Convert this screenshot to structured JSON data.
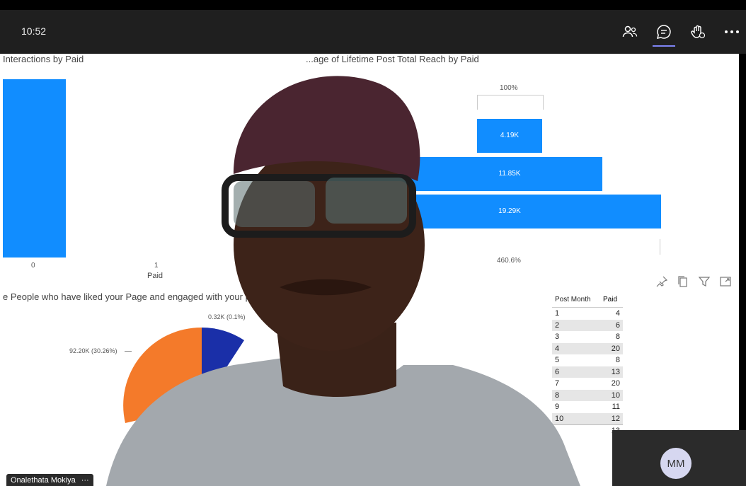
{
  "meeting": {
    "time": "10:52",
    "participant_name": "Onalethata Mokiya",
    "participant_more": "···",
    "avatar_initials": "MM",
    "icons": [
      "people-icon",
      "chat-icon",
      "raise-hand-icon",
      "more-icon"
    ]
  },
  "report": {
    "chart1": {
      "title": "Interactions by Paid",
      "x_ticks": [
        "0",
        "1"
      ],
      "xlabel": "Paid"
    },
    "chart2": {
      "title": "...age of Lifetime Post Total Reach by Paid",
      "top_pct": "100%",
      "bars": [
        "4.19K",
        "11.85K",
        "19.29K"
      ],
      "bottom_pct": "460.6%"
    },
    "chart3": {
      "title": "e People who have liked your Page and engaged with your p",
      "label_orange": "92.20K (30.26%)",
      "label_blue": "0.32K (0.1%)"
    },
    "table": {
      "headers": [
        "Post Month",
        "Paid"
      ],
      "rows": [
        [
          "1",
          "4"
        ],
        [
          "2",
          "6"
        ],
        [
          "3",
          "8"
        ],
        [
          "4",
          "20"
        ],
        [
          "5",
          "8"
        ],
        [
          "6",
          "13"
        ],
        [
          "7",
          "20"
        ],
        [
          "8",
          "10"
        ],
        [
          "9",
          "11"
        ],
        [
          "10",
          "12"
        ]
      ],
      "total": "13"
    },
    "toolbar_icons": [
      "pin-icon",
      "copy-icon",
      "filter-icon",
      "focus-mode-icon"
    ]
  },
  "chart_data": [
    {
      "type": "bar",
      "title": "Interactions by Paid",
      "categories": [
        "0",
        "1"
      ],
      "xlabel": "Paid"
    },
    {
      "type": "bar",
      "title": "...age of Lifetime Post Total Reach by Paid",
      "values_labels": [
        "4.19K",
        "11.85K",
        "19.29K"
      ],
      "values": [
        4.19,
        11.85,
        19.29
      ],
      "unit": "K"
    },
    {
      "type": "pie",
      "slices": [
        {
          "label": "92.20K (30.26%)",
          "value": 30.26,
          "color": "#f47a2a"
        },
        {
          "label": "0.32K (0.1%)",
          "value": 0.1,
          "color": "#1a2fa8"
        }
      ]
    }
  ],
  "colors": {
    "accent_blue": "#118dff",
    "pie_orange": "#f47a2a",
    "pie_navy": "#1a2fa8"
  }
}
